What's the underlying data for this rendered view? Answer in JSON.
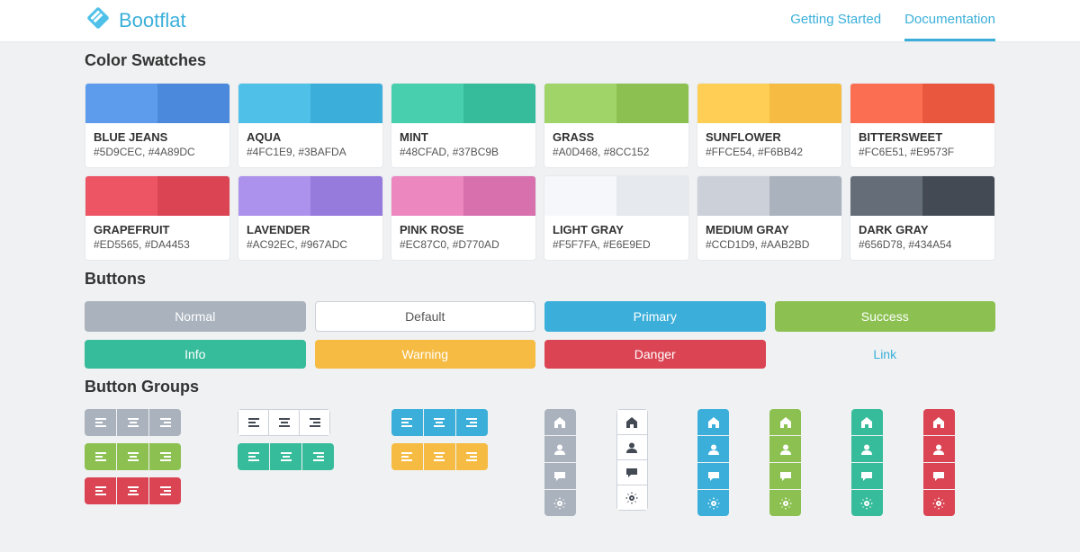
{
  "brand": "Bootflat",
  "nav": {
    "getting_started": "Getting Started",
    "documentation": "Documentation"
  },
  "sections": {
    "swatches": "Color Swatches",
    "buttons": "Buttons",
    "button_groups": "Button Groups"
  },
  "swatches": [
    {
      "name": "BLUE JEANS",
      "codes": "#5D9CEC, #4A89DC",
      "c1": "#5d9cec",
      "c2": "#4a89dc"
    },
    {
      "name": "AQUA",
      "codes": "#4FC1E9, #3BAFDA",
      "c1": "#4fc1e9",
      "c2": "#3bafda"
    },
    {
      "name": "MINT",
      "codes": "#48CFAD, #37BC9B",
      "c1": "#48cfad",
      "c2": "#37bc9b"
    },
    {
      "name": "GRASS",
      "codes": "#A0D468, #8CC152",
      "c1": "#a0d468",
      "c2": "#8cc152"
    },
    {
      "name": "SUNFLOWER",
      "codes": "#FFCE54, #F6BB42",
      "c1": "#ffce54",
      "c2": "#f6bb42"
    },
    {
      "name": "BITTERSWEET",
      "codes": "#FC6E51, #E9573F",
      "c1": "#fc6e51",
      "c2": "#e9573f"
    },
    {
      "name": "GRAPEFRUIT",
      "codes": "#ED5565, #DA4453",
      "c1": "#ed5565",
      "c2": "#da4453"
    },
    {
      "name": "LAVENDER",
      "codes": "#AC92EC, #967ADC",
      "c1": "#ac92ec",
      "c2": "#967adc"
    },
    {
      "name": "PINK ROSE",
      "codes": "#EC87C0, #D770AD",
      "c1": "#ec87c0",
      "c2": "#d770ad"
    },
    {
      "name": "LIGHT GRAY",
      "codes": "#F5F7FA, #E6E9ED",
      "c1": "#f5f7fa",
      "c2": "#e6e9ed"
    },
    {
      "name": "MEDIUM GRAY",
      "codes": "#CCD1D9, #AAB2BD",
      "c1": "#ccd1d9",
      "c2": "#aab2bd"
    },
    {
      "name": "DARK GRAY",
      "codes": "#656D78, #434A54",
      "c1": "#656d78",
      "c2": "#434a54"
    }
  ],
  "buttons": {
    "normal": "Normal",
    "default": "Default",
    "primary": "Primary",
    "success": "Success",
    "info": "Info",
    "warning": "Warning",
    "danger": "Danger",
    "link": "Link"
  }
}
